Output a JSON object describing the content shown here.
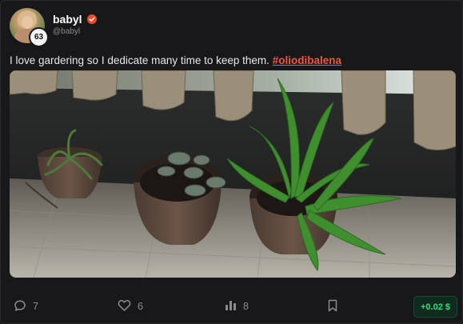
{
  "post": {
    "author": {
      "name": "babyl",
      "handle": "@babyl",
      "level": "63",
      "verified_color": "#f04a24"
    },
    "text": "I love gardering so I dedicate many time to keep them.",
    "hashtag": "#oliodibalena",
    "image_alt": "Potted plants on a tiled balcony"
  },
  "actions": {
    "comments": "7",
    "likes": "6",
    "views": "8",
    "tip": "+0.02 $"
  },
  "colors": {
    "accent": "#f0573c",
    "tip_green": "#2ee07a",
    "background": "#18181a"
  },
  "icons": [
    "comment-icon",
    "heart-icon",
    "stats-icon",
    "bookmark-icon",
    "verified-icon"
  ]
}
